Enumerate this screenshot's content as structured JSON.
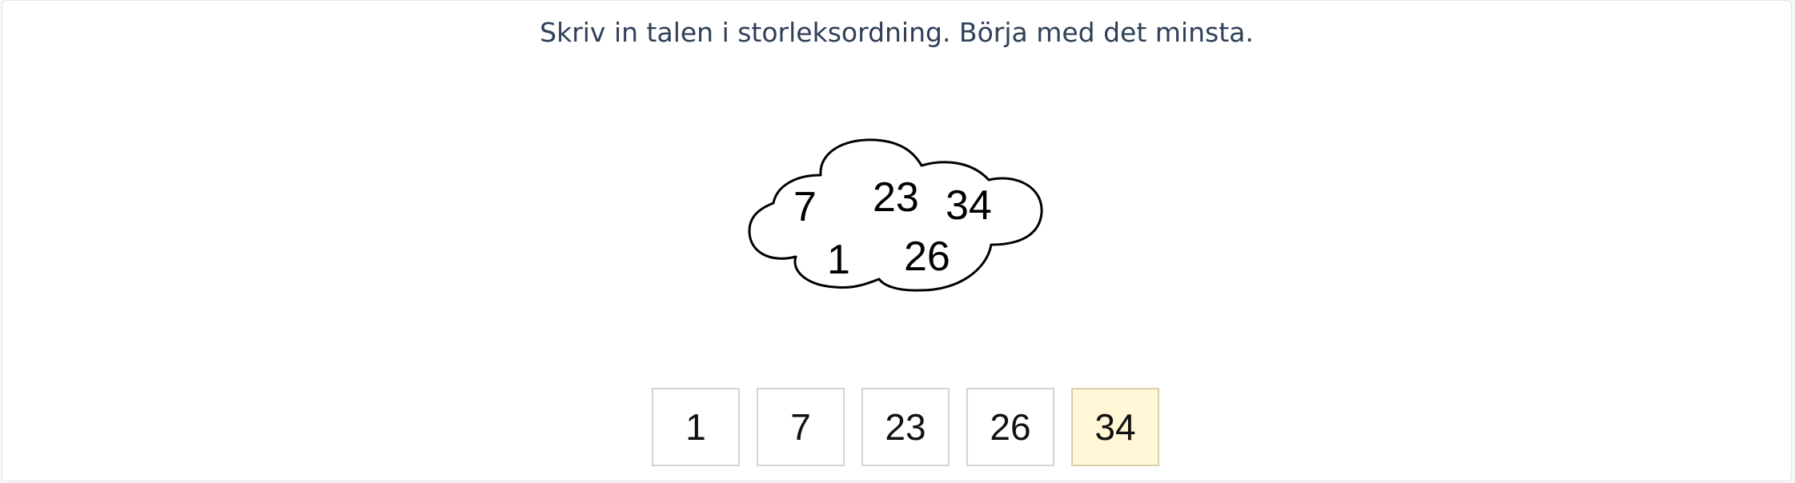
{
  "instruction": "Skriv in talen i storleksordning. Börja med det minsta.",
  "cloud": {
    "numbers": [
      "7",
      "23",
      "34",
      "1",
      "26"
    ]
  },
  "answers": {
    "values": [
      "1",
      "7",
      "23",
      "26",
      "34"
    ],
    "active_index": 4,
    "active_color": "#fff7d6"
  }
}
